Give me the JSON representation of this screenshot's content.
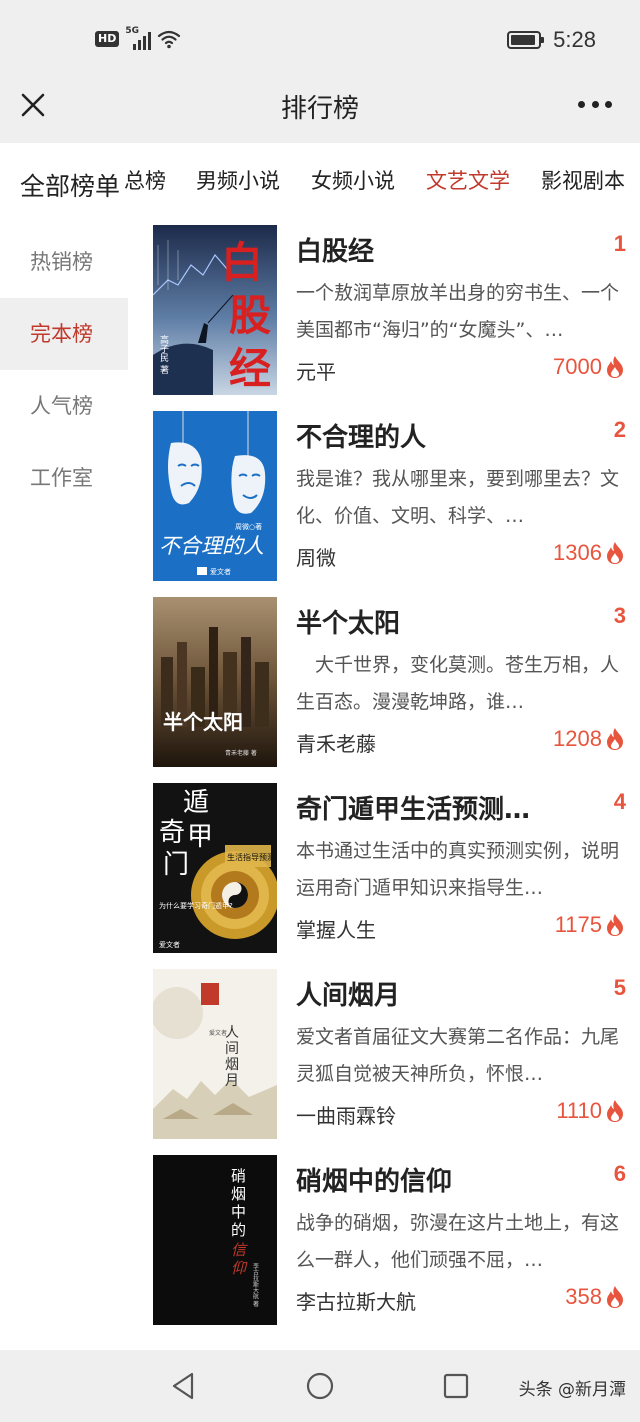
{
  "status_bar": {
    "hd": "HD",
    "network": "5G",
    "time": "5:28"
  },
  "header": {
    "title": "排行榜"
  },
  "tabs": {
    "all_label": "全部榜单",
    "items": [
      {
        "label": "总榜"
      },
      {
        "label": "男频小说"
      },
      {
        "label": "女频小说"
      },
      {
        "label": "文艺文学",
        "active": true
      },
      {
        "label": "影视剧本"
      }
    ]
  },
  "sidebar": {
    "items": [
      {
        "label": "热销榜"
      },
      {
        "label": "完本榜",
        "active": true
      },
      {
        "label": "人气榜"
      },
      {
        "label": "工作室"
      }
    ]
  },
  "books": [
    {
      "rank": "1",
      "title": "白股经",
      "desc": "一个敖润草原放羊出身的穷书生、一个美国都市“海归”的“女魔头”、…",
      "author": "元平",
      "heat": "7000",
      "cover_text": "白股经",
      "cover_author": "高子民 著"
    },
    {
      "rank": "2",
      "title": "不合理的人",
      "desc": "我是谁？我从哪里来，要到哪里去？文化、价值、文明、科学、…",
      "author": "周微",
      "heat": "1306",
      "cover_text": "不合理的人",
      "cover_author": "周微○著",
      "cover_publisher": "爱文者"
    },
    {
      "rank": "3",
      "title": "半个太阳",
      "desc": "　大千世界，变化莫测。苍生万相，人生百态。漫漫乾坤路，谁…",
      "author": "青禾老藤",
      "heat": "1208",
      "cover_text": "半个太阳",
      "cover_author": "青禾老藤 著"
    },
    {
      "rank": "4",
      "title": "奇门遁甲生活预测…",
      "desc": "本书通过生活中的真实预测实例，说明运用奇门遁甲知识来指导生…",
      "author": "掌握人生",
      "heat": "1175",
      "cover_text": "奇门遁甲",
      "cover_sub": "生活指导预测",
      "cover_question": "为什么要学习奇门遁甲?",
      "cover_publisher": "爱文者"
    },
    {
      "rank": "5",
      "title": "人间烟月",
      "desc": "爱文者首届征文大赛第二名作品：九尾灵狐自觉被天神所负，怀恨…",
      "author": "一曲雨霖铃",
      "heat": "1110",
      "cover_text": "人间烟月",
      "cover_publisher": "爱文者"
    },
    {
      "rank": "6",
      "title": "硝烟中的信仰",
      "desc": "战争的硝烟，弥漫在这片土地上，有这么一群人，他们顽强不屈，…",
      "author": "李古拉斯大航",
      "heat": "358",
      "cover_text": "硝烟中的",
      "cover_red": "信仰",
      "cover_author": "李古拉斯大航 著"
    }
  ],
  "watermark": "头条 @新月潭",
  "colors": {
    "accent": "#c0392b",
    "heat": "#e8553e",
    "header_bg": "#efefef"
  }
}
